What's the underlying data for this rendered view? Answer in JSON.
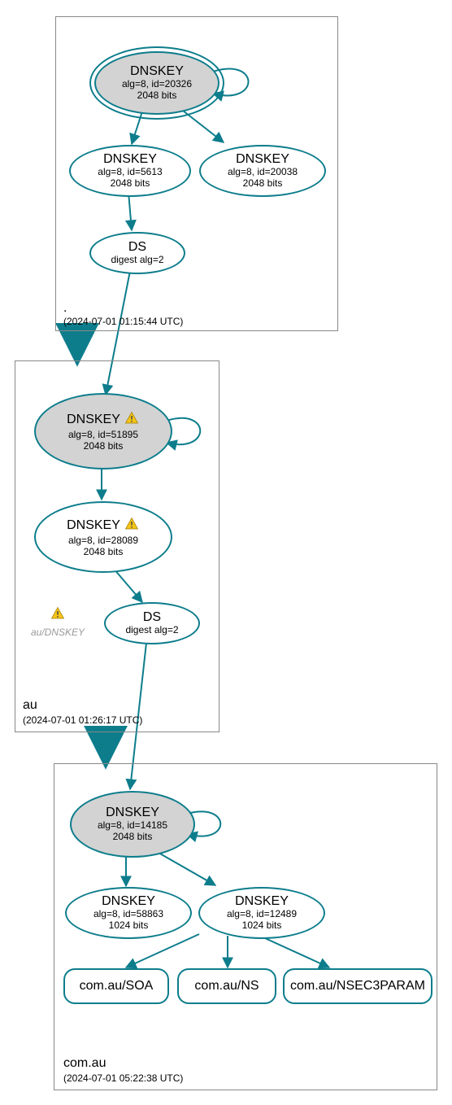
{
  "colors": {
    "stroke": "#0d7d8c",
    "fill_grey": "#d3d3d3"
  },
  "zones": {
    "root": {
      "label": ".",
      "time": "(2024-07-01 01:15:44 UTC)"
    },
    "au": {
      "label": "au",
      "time": "(2024-07-01 01:26:17 UTC)"
    },
    "com_au": {
      "label": "com.au",
      "time": "(2024-07-01 05:22:38 UTC)"
    }
  },
  "nodes": {
    "root_ksk": {
      "title": "DNSKEY",
      "line1": "alg=8, id=20326",
      "line2": "2048 bits"
    },
    "root_zsk1": {
      "title": "DNSKEY",
      "line1": "alg=8, id=5613",
      "line2": "2048 bits"
    },
    "root_zsk2": {
      "title": "DNSKEY",
      "line1": "alg=8, id=20038",
      "line2": "2048 bits"
    },
    "root_ds": {
      "title": "DS",
      "line1": "digest alg=2"
    },
    "au_ksk": {
      "title": "DNSKEY",
      "line1": "alg=8, id=51895",
      "line2": "2048 bits",
      "warn": true
    },
    "au_zsk": {
      "title": "DNSKEY",
      "line1": "alg=8, id=28089",
      "line2": "2048 bits",
      "warn": true
    },
    "au_ds": {
      "title": "DS",
      "line1": "digest alg=2"
    },
    "au_annot": {
      "label": "au/DNSKEY"
    },
    "comau_ksk": {
      "title": "DNSKEY",
      "line1": "alg=8, id=14185",
      "line2": "2048 bits"
    },
    "comau_zsk1": {
      "title": "DNSKEY",
      "line1": "alg=8, id=58863",
      "line2": "1024 bits"
    },
    "comau_zsk2": {
      "title": "DNSKEY",
      "line1": "alg=8, id=12489",
      "line2": "1024 bits"
    },
    "comau_soa": {
      "title": "com.au/SOA"
    },
    "comau_ns": {
      "title": "com.au/NS"
    },
    "comau_nsec": {
      "title": "com.au/NSEC3PARAM"
    }
  }
}
